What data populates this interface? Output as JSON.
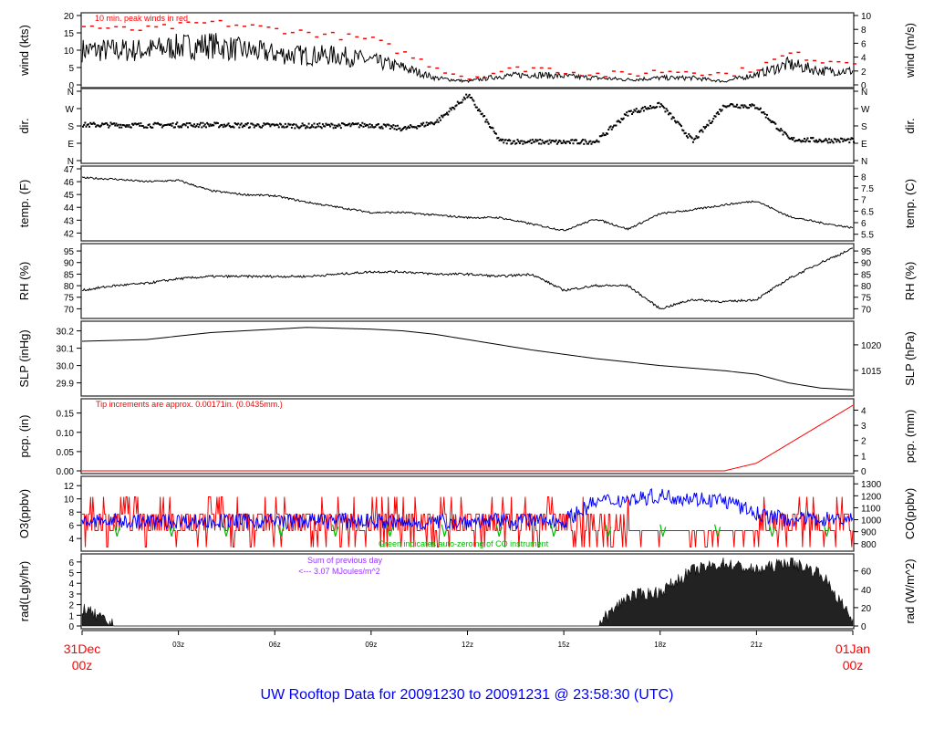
{
  "chart_data": {
    "type": "line",
    "title": "UW Rooftop Data for 20091230  to  20091231 @ 23:58:30  (UTC)",
    "x_unit": "hours UTC",
    "x_ticks": [
      "03z",
      "06z",
      "09z",
      "12z",
      "15z",
      "18z",
      "21z"
    ],
    "x_start": {
      "day": "31Dec",
      "hour": "00z"
    },
    "x_end": {
      "day": "01Jan",
      "hour": "00z"
    },
    "hours": [
      0,
      1,
      2,
      3,
      4,
      5,
      6,
      7,
      8,
      9,
      10,
      11,
      12,
      13,
      14,
      15,
      16,
      17,
      18,
      19,
      20,
      21,
      22,
      23,
      24
    ],
    "panels": [
      {
        "key": "wind",
        "ylabel": "wind (kts)",
        "ylabel_right": "wind (m/s)",
        "ylim": [
          0,
          20
        ],
        "yticks": [
          "0",
          "5",
          "10",
          "15",
          "20"
        ],
        "rticks": [
          "0",
          "2",
          "4",
          "6",
          "8",
          "10"
        ],
        "rlim": [
          0,
          10
        ],
        "note": "10 min. peak winds in red",
        "values": [
          10,
          10,
          10,
          11,
          11.5,
          10,
          9,
          8.5,
          8.5,
          7,
          5,
          2,
          1,
          2.5,
          3,
          2.5,
          2,
          1.5,
          2,
          2,
          1,
          3,
          6,
          4,
          4
        ],
        "peak_values": [
          17,
          16,
          16,
          17,
          18,
          17,
          16,
          15,
          14,
          13,
          9,
          5,
          2,
          4,
          5,
          4,
          3,
          3,
          4,
          4,
          3,
          5,
          9,
          7,
          7
        ]
      },
      {
        "key": "dir",
        "ylabel": "dir.",
        "ylabel_right": "dir.",
        "ylim": [
          0,
          360
        ],
        "yticks": [
          "N",
          "E",
          "S",
          "W",
          "N"
        ],
        "rticks": [
          "N",
          "E",
          "S",
          "W",
          "N"
        ],
        "rlim": [
          0,
          360
        ],
        "values": [
          185,
          185,
          183,
          185,
          185,
          183,
          182,
          180,
          182,
          185,
          165,
          200,
          340,
          100,
          98,
          95,
          100,
          250,
          290,
          100,
          290,
          280,
          110,
          105,
          105
        ]
      },
      {
        "key": "temp",
        "ylabel": "temp. (F)",
        "ylabel_right": "temp. (C)",
        "ylim": [
          41.6,
          47
        ],
        "yticks": [
          "42",
          "43",
          "44",
          "45",
          "46",
          "47"
        ],
        "rticks": [
          "5.5",
          "6",
          "6.5",
          "7",
          "7.5",
          "8"
        ],
        "rlim": [
          5.33,
          8.33
        ],
        "values": [
          46.3,
          46.2,
          46.0,
          46.1,
          45.3,
          45.0,
          44.9,
          44.4,
          44.0,
          43.6,
          43.6,
          43.4,
          43.2,
          43.2,
          42.7,
          42.2,
          43.1,
          42.3,
          43.5,
          43.8,
          44.2,
          44.5,
          43.3,
          42.8,
          42.4
        ]
      },
      {
        "key": "rh",
        "ylabel": "RH (%)",
        "ylabel_right": "RH (%)",
        "ylim": [
          67,
          97
        ],
        "yticks": [
          "70",
          "75",
          "80",
          "85",
          "90",
          "95"
        ],
        "rticks": [
          "70",
          "75",
          "80",
          "85",
          "90",
          "95"
        ],
        "rlim": [
          67,
          97
        ],
        "values": [
          78,
          80,
          81,
          83,
          84,
          84,
          84,
          84,
          85,
          86,
          86,
          85,
          85,
          84,
          85,
          78,
          80,
          80,
          70,
          74,
          73,
          74,
          83,
          90,
          96
        ]
      },
      {
        "key": "slp",
        "ylabel": "SLP (inHg)",
        "ylabel_right": "SLP (hPa)",
        "ylim": [
          29.84,
          30.24
        ],
        "yticks": [
          "29.9",
          "30.0",
          "30.1",
          "30.2"
        ],
        "rticks": [
          "1015",
          "1020"
        ],
        "rlim": [
          1010.5,
          1024.1
        ],
        "values": [
          30.14,
          30.145,
          30.15,
          30.17,
          30.19,
          30.2,
          30.21,
          30.22,
          30.215,
          30.21,
          30.2,
          30.18,
          30.15,
          30.12,
          30.09,
          30.065,
          30.04,
          30.02,
          30.0,
          29.985,
          29.97,
          29.95,
          29.9,
          29.87,
          29.86
        ]
      },
      {
        "key": "pcp",
        "ylabel": "pcp. (in)",
        "ylabel_right": "pcp. (mm)",
        "ylim": [
          0,
          0.18
        ],
        "yticks": [
          "0.00",
          "0.05",
          "0.10",
          "0.15"
        ],
        "rticks": [
          "0",
          "1",
          "2",
          "3",
          "4"
        ],
        "rlim": [
          0,
          4.57
        ],
        "note": "Tip increments are approx. 0.00171in. (0.0435mm.)",
        "values": [
          0,
          0,
          0,
          0,
          0,
          0,
          0,
          0,
          0,
          0,
          0,
          0,
          0,
          0,
          0,
          0,
          0,
          0,
          0,
          0,
          0,
          0.02,
          0.07,
          0.12,
          0.17
        ]
      },
      {
        "key": "o3",
        "ylabel": "O3(ppbv)",
        "ylabel_right": "CO(ppbv)",
        "ylim": [
          2.5,
          13
        ],
        "yticks": [
          "4",
          "6",
          "8",
          "10",
          "12"
        ],
        "rticks": [
          "800",
          "900",
          "1000",
          "1100",
          "1200",
          "1300"
        ],
        "rlim": [
          760,
          1340
        ],
        "note": "Green indicates auto-zeroing of CO instrument",
        "values": [
          7,
          7,
          6.5,
          7,
          7,
          6.5,
          6.5,
          7,
          7,
          6.5,
          6,
          6,
          6,
          6,
          6,
          6,
          6,
          5,
          5,
          5,
          5,
          5,
          6,
          6,
          6
        ],
        "co_values": [
          980,
          990,
          980,
          990,
          985,
          990,
          985,
          990,
          995,
          985,
          970,
          980,
          985,
          990,
          990,
          990,
          1150,
          1170,
          1200,
          1180,
          1160,
          1050,
          1000,
          1010,
          1000
        ]
      },
      {
        "key": "rad",
        "ylabel": "rad(Lgly/hr)",
        "ylabel_right": "rad (W/m^2)",
        "ylim": [
          0,
          6.5
        ],
        "yticks": [
          "0",
          "1",
          "2",
          "3",
          "4",
          "5",
          "6"
        ],
        "rticks": [
          "0",
          "20",
          "40",
          "60"
        ],
        "rlim": [
          0,
          75.6
        ],
        "note": [
          "Sum of previous day",
          "<--- 3.07 MJoules/m^2"
        ],
        "values": [
          1.7,
          0,
          0,
          0,
          0,
          0,
          0,
          0,
          0,
          0,
          0,
          0,
          0,
          0,
          0,
          0,
          0,
          2.8,
          3.2,
          5.2,
          5.9,
          5.2,
          6.0,
          5.0,
          0.5
        ]
      }
    ],
    "colors": {
      "wind": "#000000",
      "peak": "#ff0000",
      "o3": "#ff0000",
      "co": "#0000ff",
      "co_zero": "#00bb00",
      "note_red": "#ff0000",
      "note_purple": "#9933ff",
      "title": "#0000ff"
    }
  }
}
